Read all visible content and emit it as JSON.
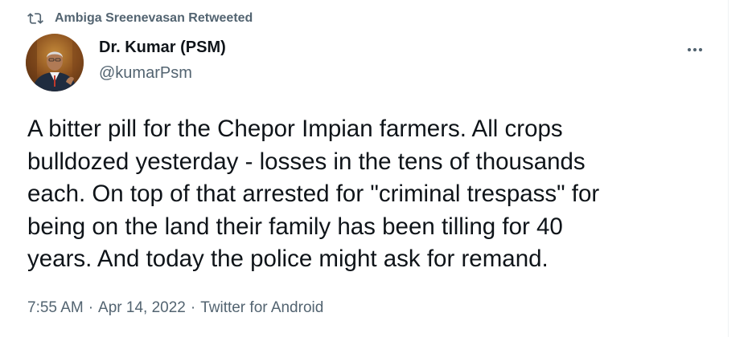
{
  "retweet": {
    "icon": "retweet-icon",
    "text": "Ambiga Sreenevasan Retweeted"
  },
  "author": {
    "display_name": "Dr. Kumar (PSM)",
    "handle": "@kumarPsm",
    "avatar_icon": "avatar-photo"
  },
  "more_icon": "more-horizontal-icon",
  "tweet": {
    "text": "A bitter pill for the Chepor Impian farmers. All crops\nbulldozed yesterday - losses in the tens of thousands\neach. On top of that arrested for \"criminal trespass\" for\nbeing on the land their family has been tilling for 40\nyears. And today the police might ask for remand."
  },
  "meta": {
    "time": "7:55 AM",
    "separator": "·",
    "date": "Apr 14, 2022",
    "source": "Twitter for Android"
  },
  "colors": {
    "text_primary": "#0f1419",
    "text_secondary": "#536471",
    "border": "#eff3f4"
  }
}
